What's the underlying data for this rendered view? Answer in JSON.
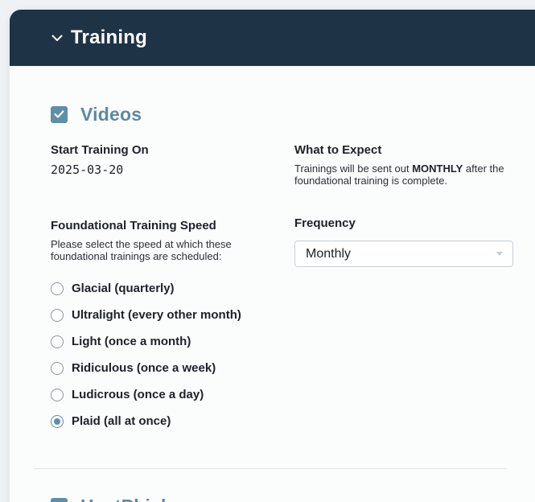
{
  "header": {
    "title": "Training",
    "icon": "chevron-down-icon"
  },
  "section": {
    "title": "Videos",
    "checked": true,
    "start": {
      "label": "Start Training On",
      "value": "2025-03-20"
    },
    "expect": {
      "label": "What to Expect",
      "text_before": "Trainings will be sent out ",
      "text_bold": "MONTHLY",
      "text_after": " after the foundational training is complete."
    },
    "speed": {
      "label": "Foundational Training Speed",
      "desc": "Please select the speed at which these foundational trainings are scheduled:",
      "options": [
        {
          "label": "Glacial (quarterly)",
          "checked": false
        },
        {
          "label": "Ultralight (every other month)",
          "checked": false
        },
        {
          "label": "Light (once a month)",
          "checked": false
        },
        {
          "label": "Ridiculous (once a week)",
          "checked": false
        },
        {
          "label": "Ludicrous (once a day)",
          "checked": false
        },
        {
          "label": "Plaid (all at once)",
          "checked": true
        }
      ]
    },
    "frequency": {
      "label": "Frequency",
      "value": "Monthly"
    }
  },
  "next_section": {
    "title": "HeatPhish",
    "checked": true
  },
  "colors": {
    "header_bg": "#1f3346",
    "accent": "#5f8ea9",
    "section_title": "#5d89a4"
  }
}
